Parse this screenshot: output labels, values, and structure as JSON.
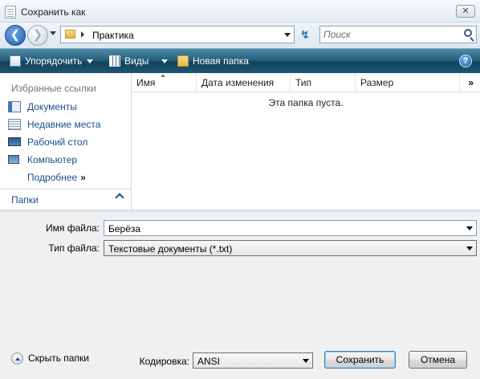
{
  "window": {
    "title": "Сохранить как",
    "close_glyph": "✕"
  },
  "address": {
    "path": "Практика",
    "back_glyph": "❮",
    "forward_glyph": "❯",
    "refresh_glyph": "↯"
  },
  "search": {
    "placeholder": "Поиск"
  },
  "toolbar": {
    "organize_label": "Упорядочить",
    "views_label": "Виды",
    "new_folder_label": "Новая папка",
    "help_glyph": "?"
  },
  "navpane": {
    "section_title": "Избранные ссылки",
    "items": [
      {
        "label": "Документы",
        "icon": "documents-icon"
      },
      {
        "label": "Недавние места",
        "icon": "recent-places-icon"
      },
      {
        "label": "Рабочий стол",
        "icon": "desktop-icon"
      },
      {
        "label": "Компьютер",
        "icon": "computer-icon"
      }
    ],
    "more_label": "Подробнее",
    "more_chevron": "»",
    "folders_label": "Папки"
  },
  "filelist": {
    "columns": [
      "Имя",
      "Дата изменения",
      "Тип",
      "Размер"
    ],
    "more_columns": "»",
    "empty_message": "Эта папка пуста."
  },
  "form": {
    "filename_label": "Имя файла:",
    "filename_value": "Берёза",
    "filetype_label": "Тип файла:",
    "filetype_value": "Текстовые документы (*.txt)",
    "encoding_label": "Кодировка:",
    "encoding_value": "ANSI"
  },
  "footer": {
    "hide_folders_label": "Скрыть папки",
    "save_label": "Сохранить",
    "cancel_label": "Отмена"
  }
}
